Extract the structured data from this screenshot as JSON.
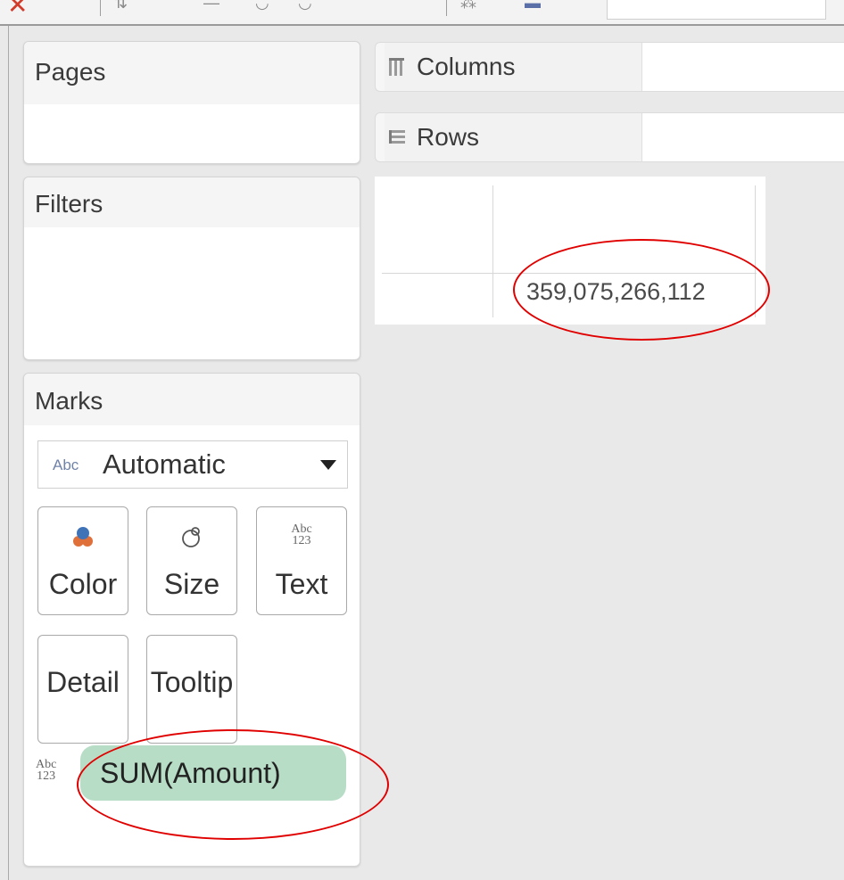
{
  "shelves": {
    "pages_title": "Pages",
    "filters_title": "Filters",
    "columns_label": "Columns",
    "rows_label": "Rows"
  },
  "view": {
    "cell_value": "359,075,266,112"
  },
  "marks": {
    "title": "Marks",
    "mark_type_prefix": "Abc",
    "mark_type": "Automatic",
    "buttons": {
      "color": "Color",
      "size": "Size",
      "text": "Text",
      "text_icon_top": "Abc",
      "text_icon_bottom": "123",
      "detail": "Detail",
      "tooltip": "Tooltip"
    },
    "field_type_top": "Abc",
    "field_type_bottom": "123",
    "field_pill": "SUM(Amount)"
  },
  "colors": {
    "annotation": "#e00000",
    "pill": "#b7ddc6",
    "color_icon_blue": "#3f73b8",
    "color_icon_orange": "#e0703a"
  },
  "icons": [
    "close-icon",
    "columns-shelf-icon",
    "rows-shelf-icon",
    "color-icon",
    "size-icon",
    "text-icon",
    "dropdown-caret-icon"
  ]
}
